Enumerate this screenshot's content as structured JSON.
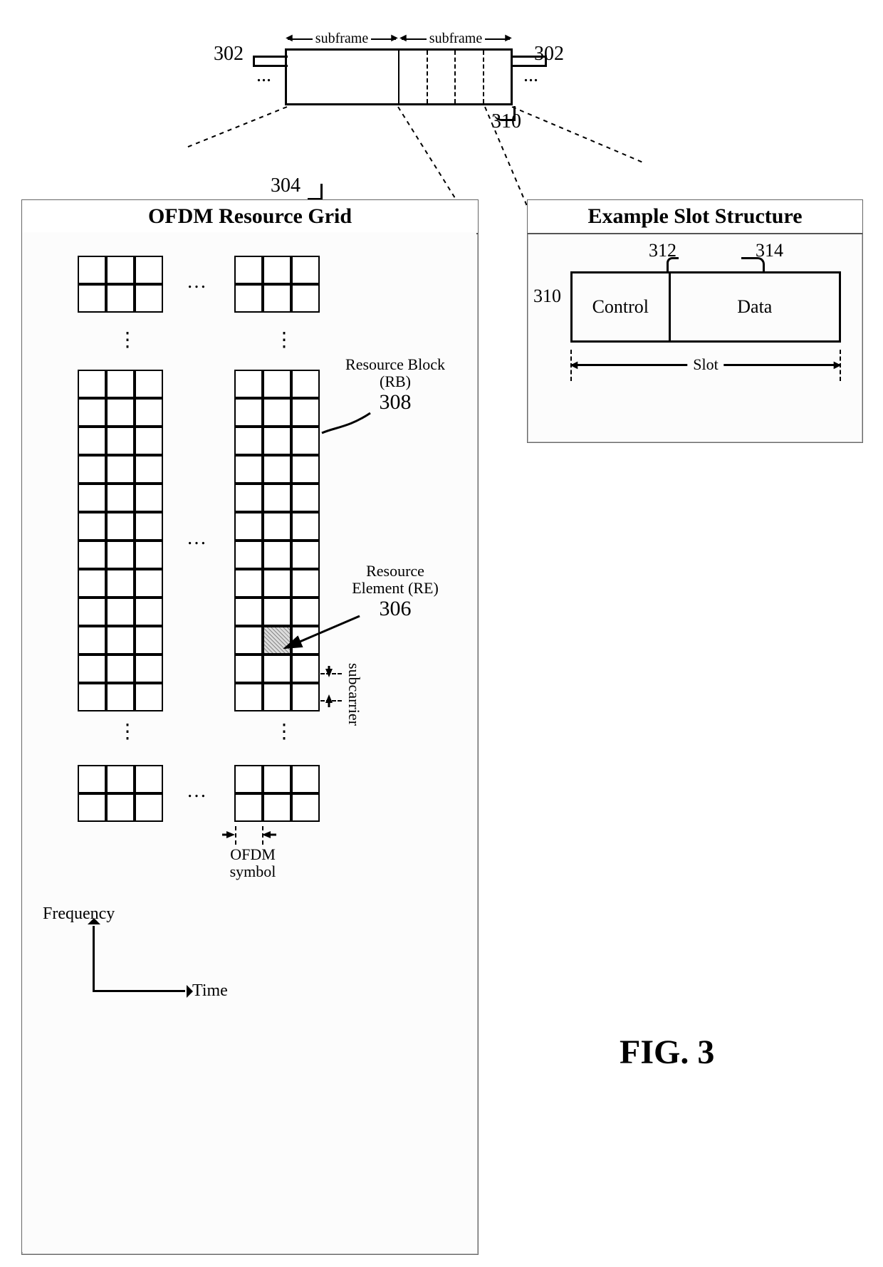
{
  "figure_label": "FIG. 3",
  "frame": {
    "subframe_label": "subframe",
    "ellipsis": "...",
    "ref_302": "302",
    "ref_310": "310",
    "ref_304": "304"
  },
  "grid_panel": {
    "title": "OFDM Resource Grid",
    "rb_label": "Resource Block\n(RB)",
    "rb_ref": "308",
    "re_label": "Resource\nElement (RE)",
    "re_ref": "306",
    "subcarrier_label": "subcarrier",
    "ofdm_symbol_label": "OFDM\nsymbol",
    "axis_frequency": "Frequency",
    "axis_time": "Time"
  },
  "slot_panel": {
    "title": "Example Slot Structure",
    "ref_310": "310",
    "ref_312": "312",
    "ref_314": "314",
    "control_label": "Control",
    "data_label": "Data",
    "slot_label": "Slot"
  }
}
